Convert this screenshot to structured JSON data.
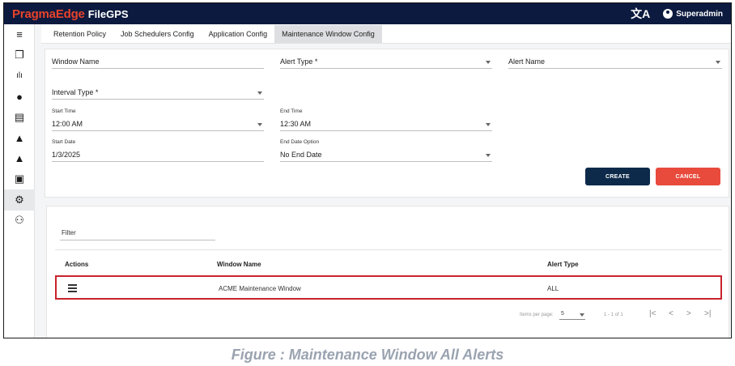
{
  "app": {
    "brand": "PragmaEdge",
    "product": "FileGPS",
    "user": "Superadmin"
  },
  "sidebar": {
    "items": [
      {
        "icon": "menu-icon",
        "glyph": "≡"
      },
      {
        "icon": "files-icon",
        "glyph": "❐"
      },
      {
        "icon": "chart-icon",
        "glyph": "ılı"
      },
      {
        "icon": "account-icon",
        "glyph": "●"
      },
      {
        "icon": "document-icon",
        "glyph": "▤"
      },
      {
        "icon": "alert-bell-icon",
        "glyph": "▲"
      },
      {
        "icon": "alert-bell-icon-2",
        "glyph": "▲"
      },
      {
        "icon": "settings-icon",
        "glyph": "▣"
      },
      {
        "icon": "user-settings-icon",
        "glyph": "⚙"
      },
      {
        "icon": "users-icon",
        "glyph": "⚇"
      }
    ]
  },
  "tabs": [
    {
      "label": "Retention Policy"
    },
    {
      "label": "Job Schedulers Config"
    },
    {
      "label": "Application Config"
    },
    {
      "label": "Maintenance Window Config"
    }
  ],
  "form": {
    "window_name": {
      "label": "Window Name"
    },
    "alert_type": {
      "label": "Alert Type *"
    },
    "alert_name": {
      "label": "Alert Name"
    },
    "interval_type": {
      "label": "Interval Type *"
    },
    "start_time": {
      "label": "Start Time",
      "value": "12:00 AM"
    },
    "end_time": {
      "label": "End Time",
      "value": "12:30 AM"
    },
    "start_date": {
      "label": "Start Date",
      "value": "1/3/2025"
    },
    "end_date_option": {
      "label": "End Date Option",
      "value": "No End Date"
    },
    "create_label": "CREATE",
    "cancel_label": "CANCEL"
  },
  "table": {
    "filter_label": "Filter",
    "columns": [
      "Actions",
      "Window Name",
      "Alert Type"
    ],
    "rows": [
      {
        "window_name": "ACME Maintenance Window",
        "alert_type": "ALL"
      }
    ],
    "pager": {
      "items_per_page_label": "Items per page:",
      "items_per_page": "5",
      "range": "1 - 1 of 1"
    }
  },
  "caption": "Figure : Maintenance Window All Alerts",
  "colors": {
    "topbar": "#0c1a3f",
    "brand": "#e8432b",
    "create": "#0d2a4a",
    "cancel": "#e84a3c",
    "highlight": "#c8232b"
  }
}
